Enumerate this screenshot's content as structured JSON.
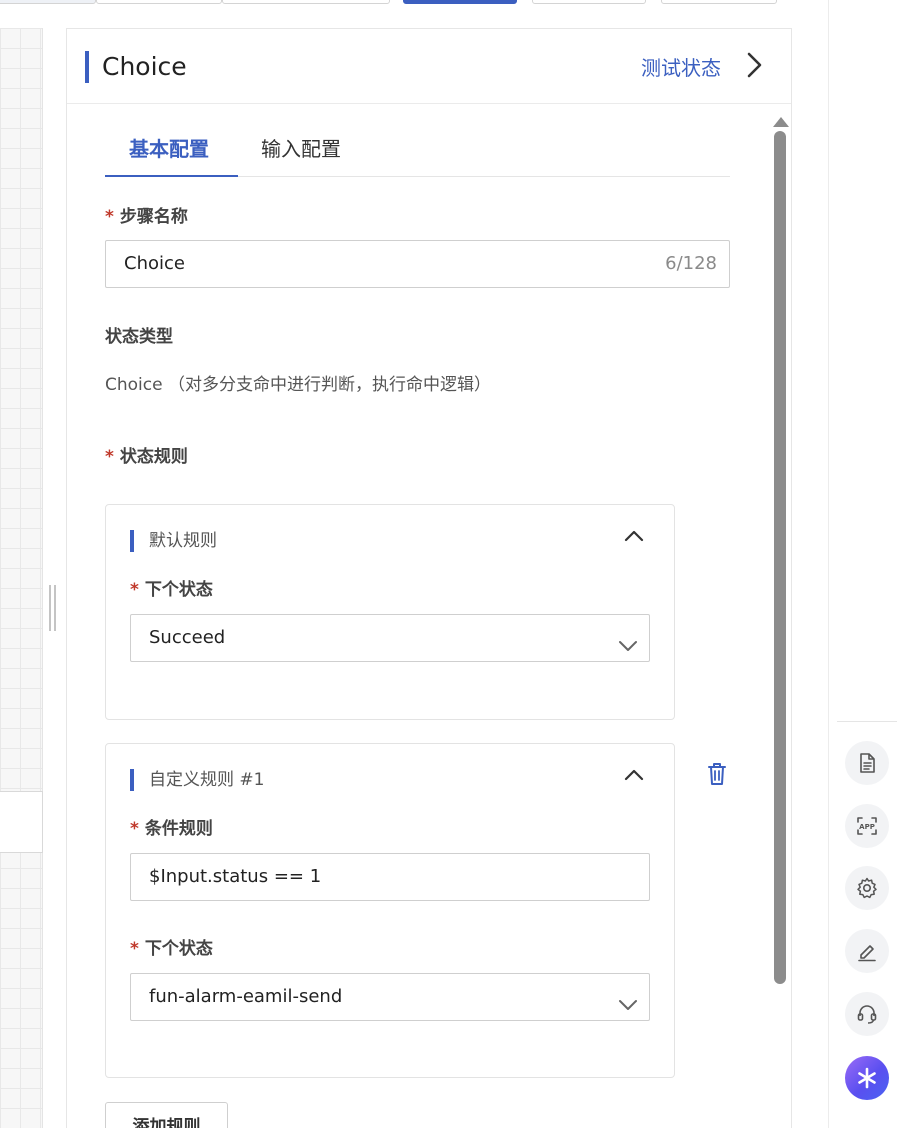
{
  "header": {
    "title": "Choice",
    "test_state_label": "测试状态"
  },
  "tabs": [
    {
      "label": "基本配置",
      "active": true
    },
    {
      "label": "输入配置",
      "active": false
    }
  ],
  "form": {
    "step_name": {
      "label": "步骤名称",
      "required_mark": "*",
      "value": "Choice",
      "counter": "6/128"
    },
    "state_type": {
      "label": "状态类型",
      "value": "Choice （对多分支命中进行判断，执行命中逻辑）"
    },
    "state_rules": {
      "label": "状态规则",
      "required_mark": "*"
    }
  },
  "rules": [
    {
      "title": "默认规则",
      "next_state_label": "下个状态",
      "next_state_value": "Succeed"
    },
    {
      "title": "自定义规则 #1",
      "condition_label": "条件规则",
      "condition_value": "$Input.status == 1",
      "next_state_label": "下个状态",
      "next_state_value": "fun-alarm-eamil-send"
    }
  ],
  "add_rule_label": "添加规则",
  "rail_icons": [
    "document-icon",
    "app-icon",
    "gear-icon",
    "edit-icon",
    "headset-icon",
    "ai-assistant-icon"
  ],
  "colors": {
    "accent": "#3b5fc0",
    "required": "#c0392b"
  }
}
